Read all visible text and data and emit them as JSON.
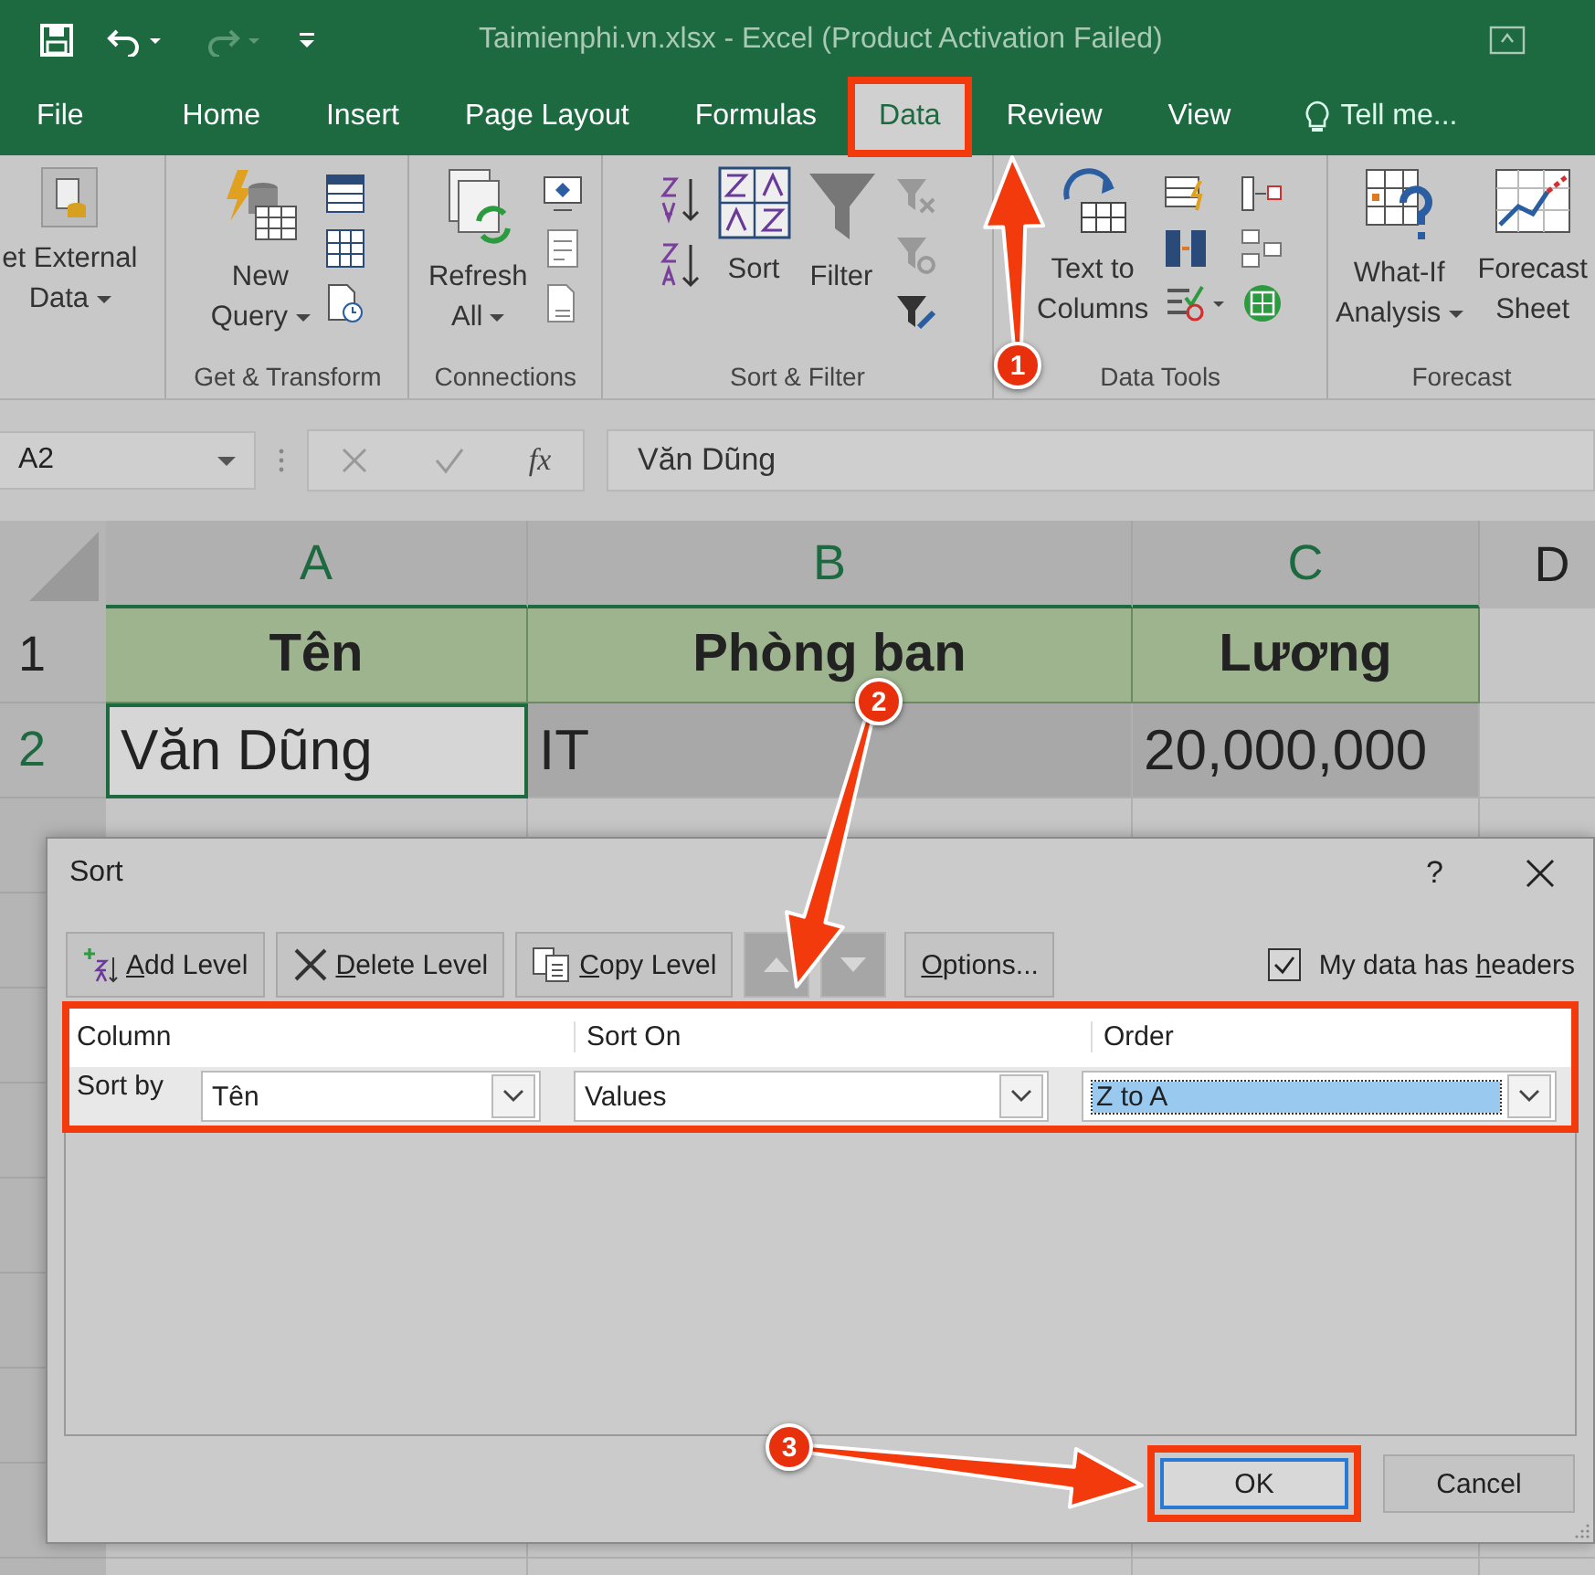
{
  "title_bar": {
    "title": "Taimienphi.vn.xlsx - Excel (Product Activation Failed)"
  },
  "tabs": [
    {
      "label": "File",
      "selected": false,
      "highlighted": false
    },
    {
      "label": "Home",
      "selected": false,
      "highlighted": false
    },
    {
      "label": "Insert",
      "selected": false,
      "highlighted": false
    },
    {
      "label": "Page Layout",
      "selected": false,
      "highlighted": false
    },
    {
      "label": "Formulas",
      "selected": false,
      "highlighted": false
    },
    {
      "label": "Data",
      "selected": true,
      "highlighted": true
    },
    {
      "label": "Review",
      "selected": false,
      "highlighted": false
    },
    {
      "label": "View",
      "selected": false,
      "highlighted": false
    }
  ],
  "tell_me": "Tell me...",
  "ribbon_groups": [
    {
      "kind": "external",
      "commands": [
        {
          "kind": "database",
          "lines": [
            "et External",
            "Data"
          ],
          "dropdown": true
        }
      ]
    },
    {
      "kind": "transform",
      "label": "Get & Transform",
      "commands": [
        {
          "kind": "query",
          "lines": [
            "New",
            "Query"
          ],
          "dropdown": true
        }
      ]
    },
    {
      "kind": "connections",
      "label": "Connections",
      "commands": [
        {
          "kind": "refresh",
          "lines": [
            "Refresh",
            "All"
          ],
          "dropdown": true
        }
      ]
    },
    {
      "kind": "sortfilter",
      "label": "Sort & Filter",
      "commands": [
        {
          "kind": "sort",
          "lines": [
            "Sort"
          ],
          "dropdown": false
        },
        {
          "kind": "filter",
          "lines": [
            "Filter"
          ],
          "dropdown": false
        }
      ]
    },
    {
      "kind": "datatools",
      "label": "Data Tools",
      "commands": [
        {
          "kind": "columns",
          "lines": [
            "Text to",
            "Columns"
          ],
          "dropdown": false
        }
      ]
    },
    {
      "kind": "forecast",
      "label": "Forecast",
      "commands": [
        {
          "kind": "whatif",
          "lines": [
            "What-If",
            "Analysis"
          ],
          "dropdown": true
        },
        {
          "kind": "forecast",
          "lines": [
            "Forecast",
            "Sheet"
          ],
          "dropdown": false
        }
      ]
    }
  ],
  "formula_bar": {
    "name_box": "A2",
    "function_label": "fx",
    "value": "Văn Dũng"
  },
  "sheet": {
    "columns": [
      {
        "label": "A",
        "selected": true
      },
      {
        "label": "B",
        "selected": true
      },
      {
        "label": "C",
        "selected": true
      },
      {
        "label": "D",
        "selected": false
      }
    ],
    "rows": [
      {
        "number": "1",
        "kind": "header",
        "selected": false,
        "cells": [
          "Tên",
          "Phòng ban",
          "Lương"
        ]
      },
      {
        "number": "2",
        "kind": "data",
        "selected": true,
        "cells": [
          "Văn Dũng",
          "IT",
          "20,000,000"
        ]
      }
    ]
  },
  "dialog": {
    "title": "Sort",
    "help": "?",
    "toolbar": [
      {
        "kind": "add",
        "key": "A",
        "after": "dd Level",
        "disabled": false
      },
      {
        "kind": "delete",
        "key": "D",
        "after": "elete Level",
        "disabled": false
      },
      {
        "kind": "copy",
        "key": "C",
        "after": "opy Level",
        "disabled": false
      },
      {
        "kind": "up",
        "disabled": true
      },
      {
        "kind": "down",
        "disabled": true
      },
      {
        "kind": "text",
        "key": "O",
        "after": "ptions...",
        "disabled": false
      }
    ],
    "headers_checkbox": {
      "before": "My data has ",
      "key": "h",
      "after": "eaders",
      "checked": true
    },
    "grid": {
      "highlighted": true,
      "headers": [
        "Column",
        "Sort On",
        "Order"
      ],
      "rows": [
        {
          "label": "Sort by",
          "column": "Tên",
          "sort_on": "Values",
          "order": "Z to A",
          "order_focused": true
        }
      ]
    },
    "buttons": [
      {
        "label": "OK",
        "default": true,
        "highlighted": true
      },
      {
        "label": "Cancel",
        "default": false,
        "highlighted": false
      }
    ]
  },
  "annotations": [
    {
      "number": "1"
    },
    {
      "number": "2"
    },
    {
      "number": "3"
    }
  ]
}
